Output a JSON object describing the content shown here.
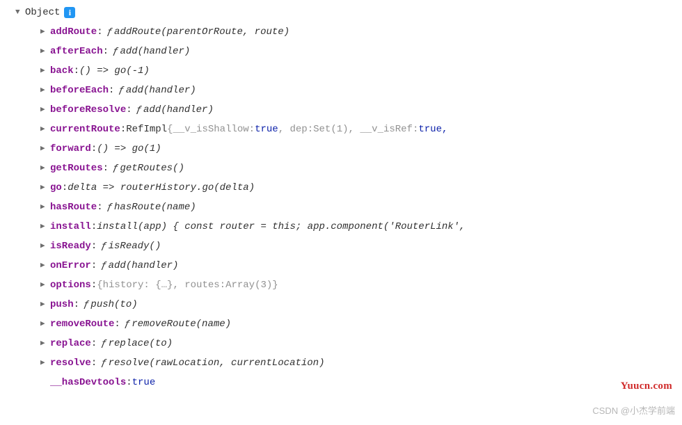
{
  "header": {
    "label": "Object"
  },
  "props": [
    {
      "key": "addRoute",
      "type": "fn",
      "sig": "addRoute(parentOrRoute, route)"
    },
    {
      "key": "afterEach",
      "type": "fn",
      "sig": "add(handler)"
    },
    {
      "key": "back",
      "type": "arrow",
      "sig": "() => go(-1)"
    },
    {
      "key": "beforeEach",
      "type": "fn",
      "sig": "add(handler)"
    },
    {
      "key": "beforeResolve",
      "type": "fn",
      "sig": "add(handler)"
    },
    {
      "key": "currentRoute",
      "type": "refimpl"
    },
    {
      "key": "forward",
      "type": "arrow",
      "sig": "() => go(1)"
    },
    {
      "key": "getRoutes",
      "type": "fn",
      "sig": "getRoutes()"
    },
    {
      "key": "go",
      "type": "arrow",
      "sig": "delta => routerHistory.go(delta)"
    },
    {
      "key": "hasRoute",
      "type": "fn",
      "sig": "hasRoute(name)"
    },
    {
      "key": "install",
      "type": "install"
    },
    {
      "key": "isReady",
      "type": "fn",
      "sig": "isReady()"
    },
    {
      "key": "onError",
      "type": "fn",
      "sig": "add(handler)"
    },
    {
      "key": "options",
      "type": "options"
    },
    {
      "key": "push",
      "type": "fn",
      "sig": "push(to)"
    },
    {
      "key": "removeRoute",
      "type": "fn",
      "sig": "removeRoute(name)"
    },
    {
      "key": "replace",
      "type": "fn",
      "sig": "replace(to)"
    },
    {
      "key": "resolve",
      "type": "fn",
      "sig": "resolve(rawLocation, currentLocation)"
    },
    {
      "key": "__hasDevtools",
      "type": "bool",
      "val": "true"
    }
  ],
  "refimpl": {
    "class": "RefImpl",
    "isShallowKey": "__v_isShallow",
    "isShallowVal": "true",
    "depKey": "dep",
    "depVal": "Set(1)",
    "isRefKey": "__v_isRef",
    "isRefVal": "true"
  },
  "install": {
    "text": "install(app) { const router = this; app.component('RouterLink',"
  },
  "options": {
    "historyKey": "history",
    "historyVal": "{…}",
    "routesKey": "routes",
    "routesVal": "Array(3)"
  },
  "watermarks": {
    "w1": "Yuucn.com",
    "w2": "CSDN @小杰学前端"
  }
}
